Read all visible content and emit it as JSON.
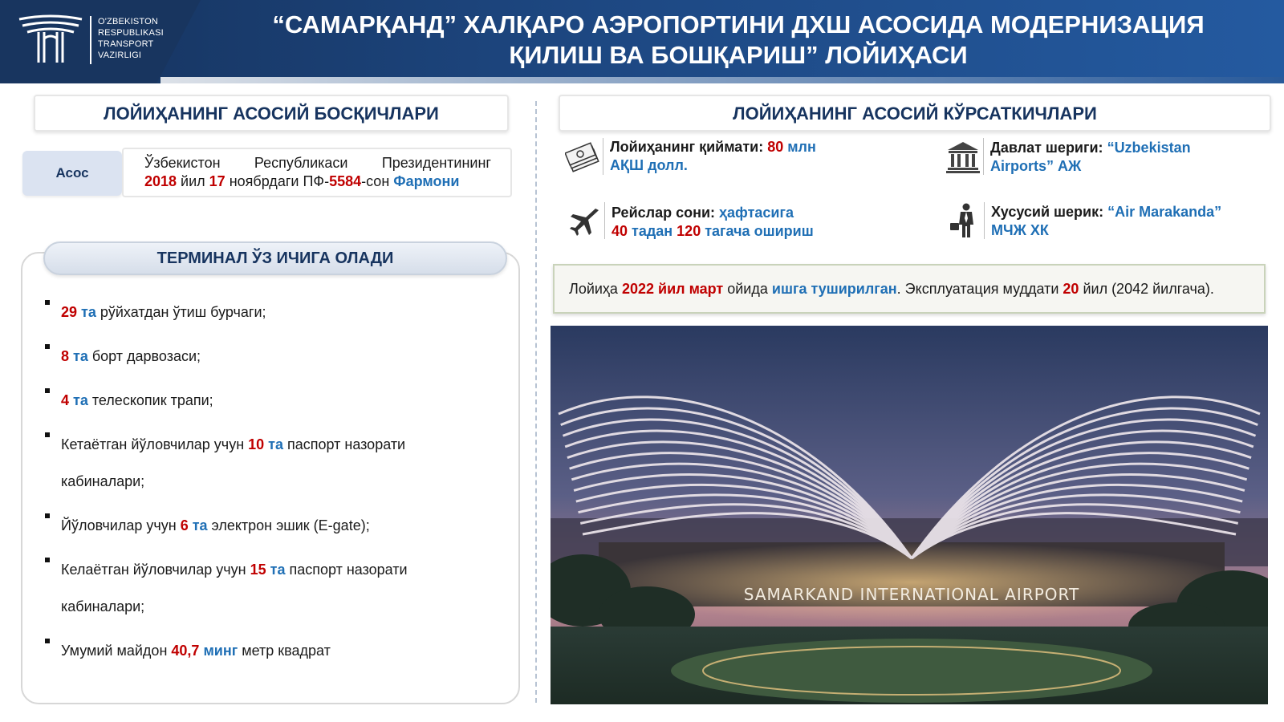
{
  "header": {
    "logo_lines": [
      "O'ZBEKISTON",
      "RESPUBLIKASI",
      "TRANSPORT",
      "VAZIRLIGI"
    ],
    "title_line1": "“САМАРҚАНД” ХАЛҚАРО АЭРОПОРТИНИ ДХШ АСОСИДА МОДЕРНИЗАЦИЯ",
    "title_line2": "ҚИЛИШ ВА БОШҚАРИШ” ЛОЙИҲАСИ",
    "logo_icon": "transport-ministry-logo"
  },
  "stages": {
    "heading": "ЛОЙИҲАНИНГ АСОСИЙ БОСҚИЧЛАРИ",
    "basis_label": "Асос",
    "basis": {
      "w1": "Ўзбекистон",
      "w2": "Республикаси",
      "w3": "Президентининг",
      "year": "2018",
      "t1": " йил ",
      "day": "17",
      "t2": " ноябрдаги ПФ-",
      "num": "5584",
      "t3": "-сон ",
      "decree": "Фармони"
    }
  },
  "terminal": {
    "heading": "ТЕРМИНАЛ ЎЗ ИЧИГА ОЛАДИ",
    "items": [
      {
        "pre": "",
        "num": "29",
        "unit": " та",
        "post": " рўйхатдан ўтиш бурчаги;",
        "line2": ""
      },
      {
        "pre": "",
        "num": "8",
        "unit": " та",
        "post": " борт дарвозаси;",
        "line2": ""
      },
      {
        "pre": "",
        "num": "4",
        "unit": " та",
        "post": " телескопик трапи;",
        "line2": ""
      },
      {
        "pre": "Кетаётган йўловчилар учун ",
        "num": "10",
        "unit": " та",
        "post": " паспорт назорати",
        "line2": "кабиналари;"
      },
      {
        "pre": "Йўловчилар учун ",
        "num": "6",
        "unit": " та",
        "post": " электрон эшик (E-gate);",
        "line2": ""
      },
      {
        "pre": "Келаётган йўловчилар учун ",
        "num": "15",
        "unit": " та",
        "post": " паспорт назорати",
        "line2": "кабиналари;"
      },
      {
        "pre": "Умумий майдон ",
        "num": "40,7",
        "unit": " минг",
        "post": " метр квадрат",
        "line2": ""
      }
    ]
  },
  "indicators": {
    "heading": "ЛОЙИҲАНИНГ АСОСИЙ КЎРСАТКИЧЛАРИ",
    "cost": {
      "icon": "money-icon",
      "label": "Лойиҳанинг қиймати: ",
      "value": "80",
      "unit": " млн",
      "line2": "АҚШ долл."
    },
    "state": {
      "icon": "government-building-icon",
      "label": "Давлат шериги: ",
      "value": "“Uzbekistan",
      "line2": "Airports” АЖ"
    },
    "flights": {
      "icon": "airplane-icon",
      "label": "Рейслар сони: ",
      "value": "ҳафтасига",
      "from": "40",
      "t1": " тадан ",
      "to": "120",
      "t2": " тагача ошириш"
    },
    "private": {
      "icon": "businessman-icon",
      "label": "Хусусий шерик: ",
      "value": "“Air Marakanda”",
      "line2": "МЧЖ ХК"
    }
  },
  "launch": {
    "t1": "Лойиҳа ",
    "date": "2022 йил март",
    "t2": " ойида ",
    "status": "ишга туширилган",
    "t3": ". Эксплуатация муддати ",
    "years": "20",
    "t4": " йил (2042 йилгача)."
  },
  "photo": {
    "signage": "SAMARKAND INTERNATIONAL AIRPORT",
    "colors": {
      "sky_top": "#2d3d63",
      "sky_bottom": "#b07a8a",
      "lights": "#ffd38a"
    }
  }
}
